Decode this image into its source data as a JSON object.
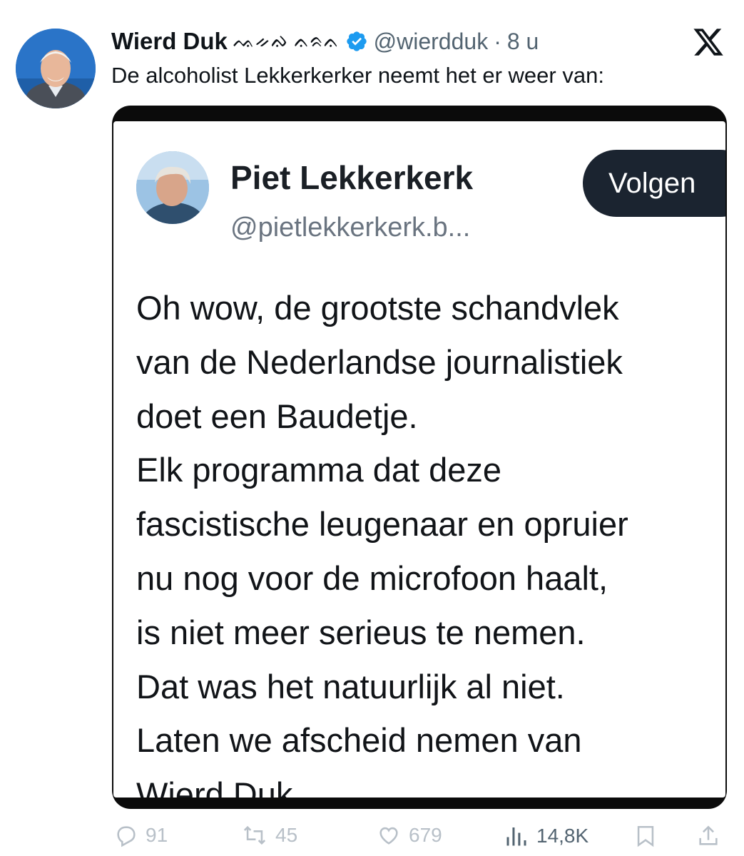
{
  "tweet": {
    "author_name": "Wierd Duk",
    "author_flags": "ᨕᨀᨁ ᨊᨑᨊ",
    "handle": "@wierdduk",
    "separator": "·",
    "time": "8 u",
    "text": "De alcoholist Lekkerkerker neemt het er weer van:"
  },
  "embedded_post": {
    "author_name": "Piet Lekkerkerk",
    "handle": "@pietlekkerkerk.b...",
    "follow_label": "Volgen",
    "lines": [
      "Oh wow, de grootste schandvlek",
      "van de Nederlandse journalistiek",
      "doet een Baudetje.",
      "Elk programma dat deze",
      "fascistische leugenaar en opruier",
      "nu nog voor de microfoon haalt,",
      "is niet meer serieus te nemen.",
      "Dat was het natuurlijk al niet.",
      "Laten we afscheid nemen van",
      "Wierd Duk."
    ]
  },
  "actions": {
    "replies": "91",
    "reposts": "45",
    "likes": "679",
    "views": "14,8K"
  },
  "icons": {
    "verified": "verified-badge-icon",
    "logo": "x-logo-icon",
    "reply": "reply-icon",
    "repost": "repost-icon",
    "like": "heart-icon",
    "views": "views-icon",
    "bookmark": "bookmark-icon",
    "share": "share-icon"
  },
  "colors": {
    "verified": "#1d9bf0",
    "muted_text": "#536471",
    "follow_button": "#1b2430"
  }
}
